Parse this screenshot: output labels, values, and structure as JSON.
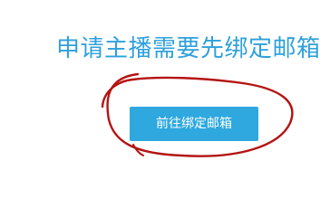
{
  "page": {
    "title": "申请主播需要先绑定邮箱"
  },
  "actions": {
    "bind_email_label": "前往绑定邮箱"
  },
  "colors": {
    "title": "#2ea0db",
    "button_bg": "#2ea8df",
    "button_text": "#ffffff",
    "annotation": "#b51313"
  }
}
